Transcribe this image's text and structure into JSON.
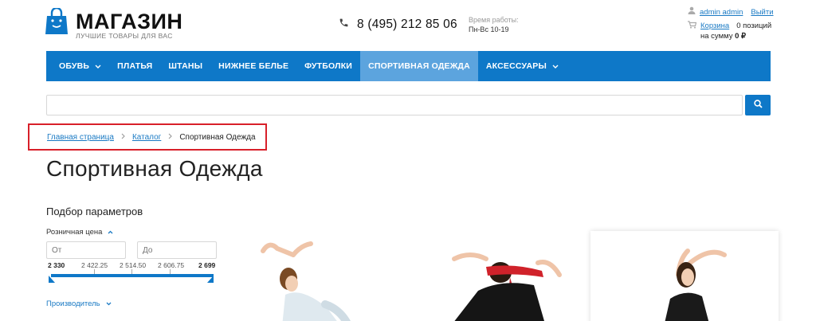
{
  "header": {
    "logo_name": "МАГАЗИН",
    "logo_tagline": "ЛУЧШИЕ ТОВАРЫ ДЛЯ ВАС",
    "phone": "8 (495) 212 85 06",
    "hours_label": "Время работы:",
    "hours_value": "Пн-Вс 10-19",
    "user_name": "admin admin",
    "logout": "Выйти",
    "basket_label": "Корзина",
    "basket_count": "0 позиций",
    "basket_sum_prefix": "на сумму",
    "basket_sum": "0 ₽"
  },
  "nav": {
    "items": [
      {
        "label": "ОБУВЬ",
        "dropdown": true
      },
      {
        "label": "ПЛАТЬЯ"
      },
      {
        "label": "ШТАНЫ"
      },
      {
        "label": "НИЖНЕЕ БЕЛЬЕ"
      },
      {
        "label": "ФУТБОЛКИ"
      },
      {
        "label": "СПОРТИВНАЯ ОДЕЖДА",
        "active": true
      },
      {
        "label": "АКСЕССУАРЫ",
        "dropdown": true
      }
    ]
  },
  "search": {
    "value": ""
  },
  "breadcrumb": {
    "home": "Главная страница",
    "catalog": "Каталог",
    "current": "Спортивная Одежда"
  },
  "page": {
    "title": "Спортивная Одежда"
  },
  "filter": {
    "title": "Подбор параметров",
    "price_label": "Розничная цена",
    "from_placeholder": "От",
    "to_placeholder": "До",
    "ticks": [
      "2 330",
      "2 422.25",
      "2 514.50",
      "2 606.75",
      "2 699"
    ],
    "range_min": 2330,
    "range_max": 2699,
    "manufacturer_label": "Производитель"
  },
  "colors": {
    "accent": "#0e78c8",
    "active_nav": "#5ca4de",
    "highlight": "#d8202a"
  }
}
